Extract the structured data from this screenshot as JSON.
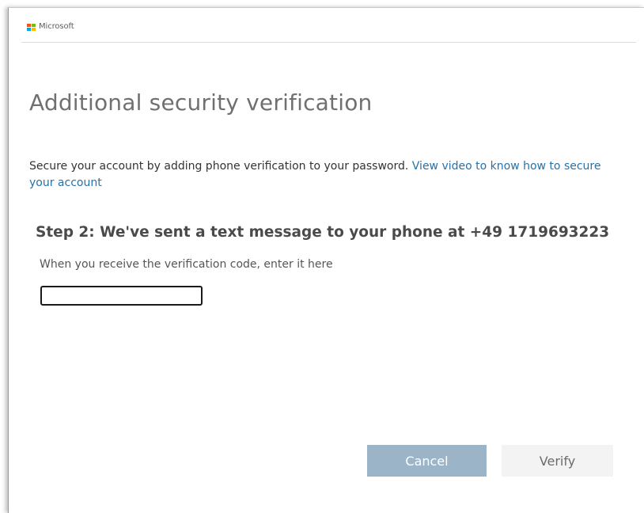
{
  "header": {
    "brand": "Microsoft",
    "logo_colors": [
      "#f25022",
      "#7fba00",
      "#00a4ef",
      "#ffb900"
    ]
  },
  "page": {
    "title": "Additional security verification",
    "intro_text": "Secure your account by adding phone verification to your password. ",
    "intro_link": "View video to know how to secure your account"
  },
  "step": {
    "title": "Step 2: We've sent a text message to your phone at +49 1719693223",
    "label": "When you receive the verification code, enter it here",
    "code_value": ""
  },
  "actions": {
    "cancel_label": "Cancel",
    "verify_label": "Verify"
  },
  "colors": {
    "link": "#2672a8",
    "cancel_bg": "#9cb4c7",
    "verify_bg": "#f3f3f3"
  }
}
